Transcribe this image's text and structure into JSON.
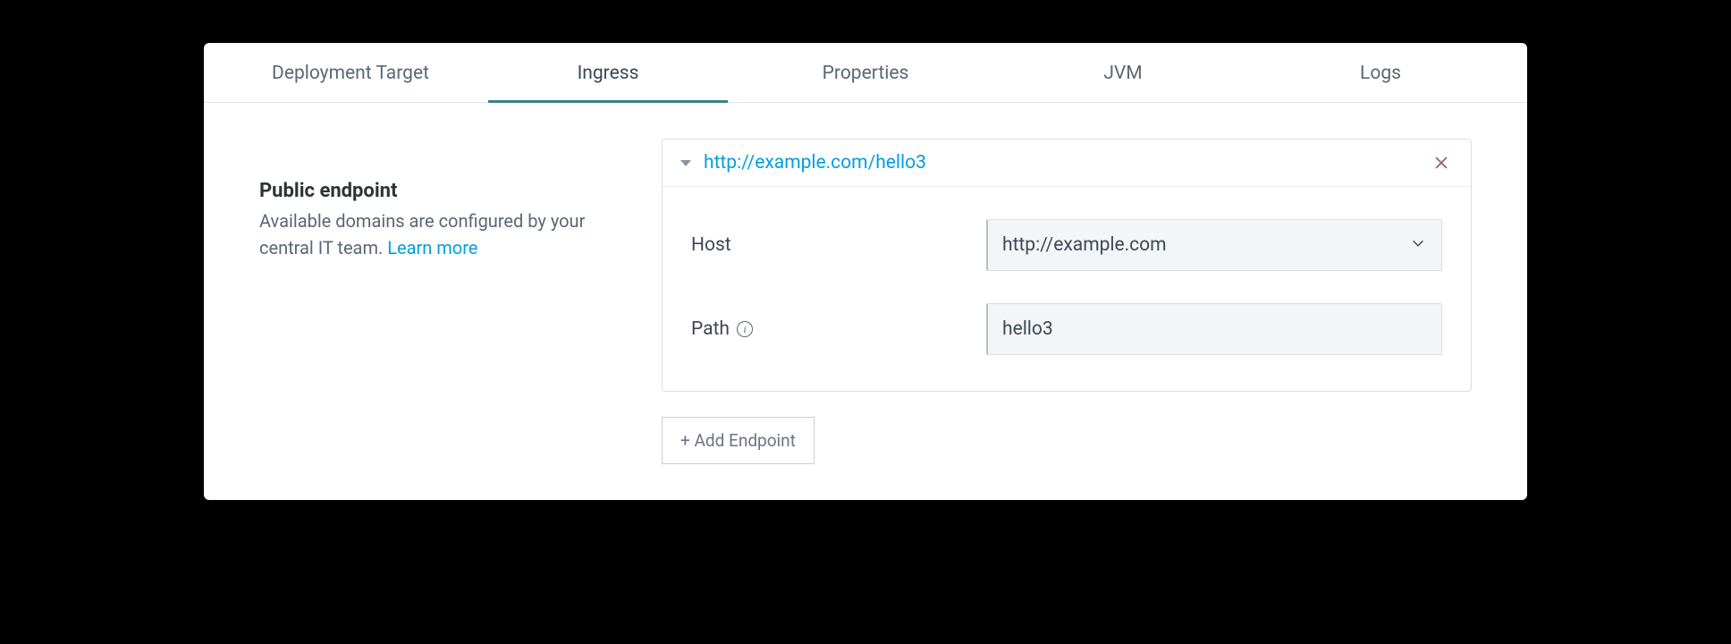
{
  "tabs": [
    {
      "label": "Deployment Target",
      "active": false
    },
    {
      "label": "Ingress",
      "active": true
    },
    {
      "label": "Properties",
      "active": false
    },
    {
      "label": "JVM",
      "active": false
    },
    {
      "label": "Logs",
      "active": false
    }
  ],
  "sidebar": {
    "title": "Public endpoint",
    "description_prefix": "Available domains are configured by your central IT team. ",
    "learn_more": "Learn more"
  },
  "endpoint": {
    "url": "http://example.com/hello3",
    "host_label": "Host",
    "host_value": "http://example.com",
    "path_label": "Path",
    "path_value": "hello3"
  },
  "add_button": "+ Add Endpoint"
}
